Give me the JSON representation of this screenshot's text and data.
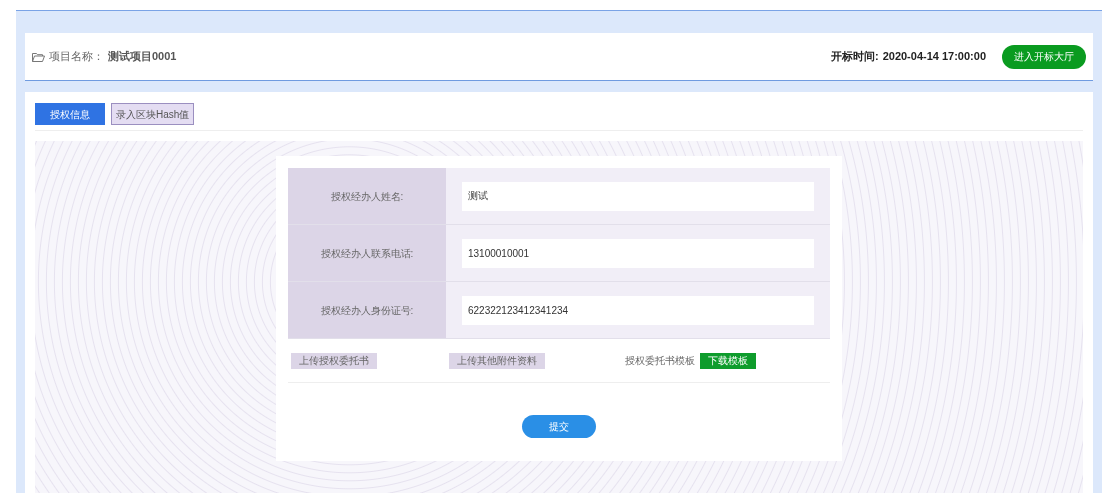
{
  "header": {
    "project_label": "项目名称：",
    "project_name": "测试项目0001",
    "time_label": "开标时间:",
    "time_value": "2020-04-14 17:00:00",
    "enter_button": "进入开标大厅"
  },
  "tabs": [
    {
      "label": "授权信息",
      "selected": true
    },
    {
      "label": "录入区块Hash值",
      "selected": false
    }
  ],
  "form": {
    "fields": [
      {
        "label": "授权经办人姓名:",
        "value": "测试"
      },
      {
        "label": "授权经办人联系电话:",
        "value": "13100010001"
      },
      {
        "label": "授权经办人身份证号:",
        "value": "622322123412341234"
      }
    ],
    "upload_buttons": [
      "上传授权委托书",
      "上传其他附件资料"
    ],
    "template_label": "授权委托书模板",
    "download_button": "下载模板",
    "submit_button": "提交"
  }
}
